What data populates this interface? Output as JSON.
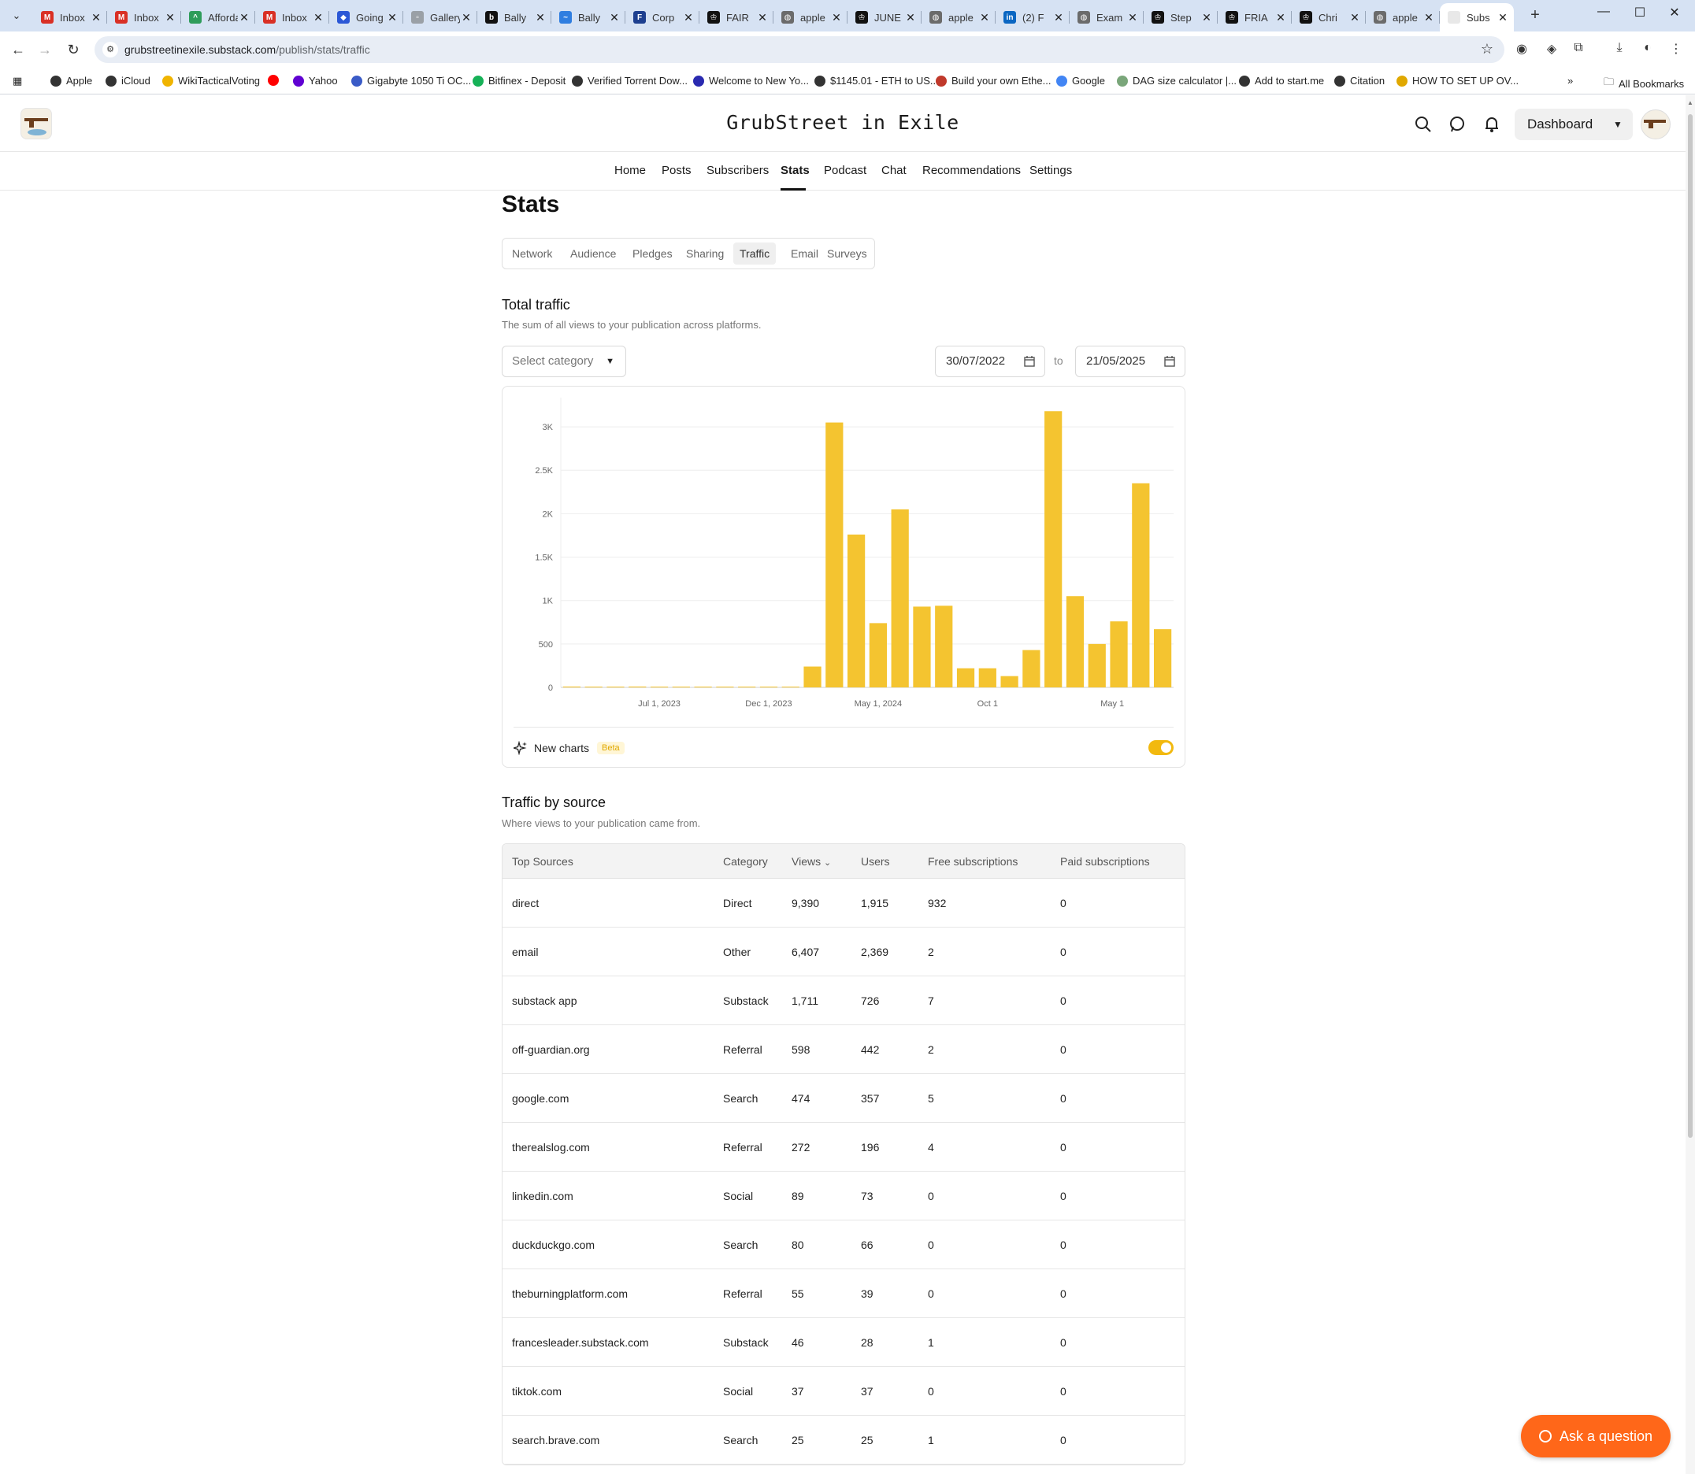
{
  "browser": {
    "tabs": [
      {
        "title": "Inbox",
        "favicon": "gmail-icon",
        "color": "#d93025",
        "glyph": "M"
      },
      {
        "title": "Inbox",
        "favicon": "gmail-icon",
        "color": "#d93025",
        "glyph": "M"
      },
      {
        "title": "Affordable",
        "favicon": "site-icon",
        "color": "#2e9c5a",
        "glyph": "^"
      },
      {
        "title": "Inbox",
        "favicon": "gmail-icon",
        "color": "#d93025",
        "glyph": "M"
      },
      {
        "title": "Going",
        "favicon": "site-icon",
        "color": "#2b57d6",
        "glyph": "◆"
      },
      {
        "title": "Gallery",
        "favicon": "site-icon",
        "color": "#9aa0a6",
        "glyph": "▫"
      },
      {
        "title": "Bally",
        "favicon": "site-icon",
        "color": "#111111",
        "glyph": "b"
      },
      {
        "title": "Bally",
        "favicon": "site-icon",
        "color": "#2f7ee0",
        "glyph": "~"
      },
      {
        "title": "Corp",
        "favicon": "site-icon",
        "color": "#1d3f8f",
        "glyph": "F"
      },
      {
        "title": "FAIR",
        "favicon": "site-icon",
        "color": "#111111",
        "glyph": "♔"
      },
      {
        "title": "apple",
        "favicon": "globe-icon",
        "color": "#6b6b6b",
        "glyph": "◍"
      },
      {
        "title": "JUNE",
        "favicon": "site-icon",
        "color": "#111111",
        "glyph": "♔"
      },
      {
        "title": "apple",
        "favicon": "globe-icon",
        "color": "#6b6b6b",
        "glyph": "◍"
      },
      {
        "title": "(2) F",
        "favicon": "linkedin-icon",
        "color": "#0a66c2",
        "glyph": "in"
      },
      {
        "title": "Exam",
        "favicon": "globe-icon",
        "color": "#6b6b6b",
        "glyph": "◍"
      },
      {
        "title": "Step",
        "favicon": "site-icon",
        "color": "#111111",
        "glyph": "♔"
      },
      {
        "title": "FRIA",
        "favicon": "site-icon",
        "color": "#111111",
        "glyph": "♔"
      },
      {
        "title": "Chri",
        "favicon": "site-icon",
        "color": "#111111",
        "glyph": "♔"
      },
      {
        "title": "apple",
        "favicon": "globe-icon",
        "color": "#6b6b6b",
        "glyph": "◍"
      },
      {
        "title": "Subs",
        "favicon": "substack-icon",
        "color": "#e8e8e8",
        "glyph": "",
        "active": true
      }
    ],
    "url_domain": "grubstreetinexile.substack.com",
    "url_path": "/publish/stats/traffic",
    "bookmarks": [
      {
        "label": "Apple",
        "color": "#333333"
      },
      {
        "label": "iCloud",
        "color": "#333333"
      },
      {
        "label": "WikiTacticalVoting",
        "color": "#f0b400"
      },
      {
        "label": "",
        "color": "#ff0000"
      },
      {
        "label": "Yahoo",
        "color": "#6001d2"
      },
      {
        "label": "Gigabyte 1050 Ti OC...",
        "color": "#3a5bc7"
      },
      {
        "label": "Bitfinex - Deposit",
        "color": "#16b157"
      },
      {
        "label": "Verified Torrent Dow...",
        "color": "#333333"
      },
      {
        "label": "Welcome to New Yo...",
        "color": "#2a2ab0"
      },
      {
        "label": "$1145.01 - ETH to US...",
        "color": "#333333"
      },
      {
        "label": "Build your own Ethe...",
        "color": "#c0392b"
      },
      {
        "label": "Google",
        "color": "#4285f4"
      },
      {
        "label": "DAG size calculator |...",
        "color": "#7aa67a"
      },
      {
        "label": "Add to start.me",
        "color": "#333333"
      },
      {
        "label": "Citation",
        "color": "#333333"
      },
      {
        "label": "HOW TO SET UP OV...",
        "color": "#e0a800"
      }
    ],
    "all_bookmarks": "All Bookmarks"
  },
  "header": {
    "pub_title": "GrubStreet in Exile",
    "dashboard_label": "Dashboard"
  },
  "nav": {
    "items": [
      "Home",
      "Posts",
      "Subscribers",
      "Stats",
      "Podcast",
      "Chat",
      "Recommendations",
      "Settings"
    ],
    "active": "Stats"
  },
  "page": {
    "title": "Stats",
    "subtabs": [
      "Network",
      "Audience",
      "Pledges",
      "Sharing",
      "Traffic",
      "Email",
      "Surveys"
    ],
    "active_subtab": "Traffic"
  },
  "total_traffic": {
    "title": "Total traffic",
    "subtitle": "The sum of all views to your publication across platforms.",
    "category_placeholder": "Select category",
    "date_from": "30/07/2022",
    "date_to": "21/05/2025",
    "to_label": "to",
    "new_charts_label": "New charts",
    "beta_label": "Beta",
    "toggle_on": true
  },
  "chart_data": {
    "type": "bar",
    "color": "#f4c430",
    "y_ticks": [
      "0",
      "500",
      "1K",
      "1.5K",
      "2K",
      "2.5K",
      "3K"
    ],
    "ylim": [
      0,
      3300
    ],
    "x_tick_labels": [
      "Jul 1, 2023",
      "Dec 1, 2023",
      "May 1, 2024",
      "Oct 1",
      "May 1"
    ],
    "x_tick_positions": [
      4.5,
      9.5,
      14.5,
      19.5,
      25.2
    ],
    "values": [
      10,
      5,
      3,
      10,
      8,
      6,
      5,
      3,
      3,
      2,
      2,
      240,
      3050,
      1760,
      740,
      2050,
      930,
      940,
      220,
      220,
      130,
      430,
      3180,
      1050,
      500,
      760,
      2350,
      670
    ],
    "grid": true
  },
  "traffic_by_source": {
    "title": "Traffic by source",
    "subtitle": "Where views to your publication came from.",
    "columns": [
      "Top Sources",
      "Category",
      "Views",
      "Users",
      "Free subscriptions",
      "Paid subscriptions"
    ],
    "rows": [
      [
        "direct",
        "Direct",
        "9,390",
        "1,915",
        "932",
        "0"
      ],
      [
        "email",
        "Other",
        "6,407",
        "2,369",
        "2",
        "0"
      ],
      [
        "substack app",
        "Substack",
        "1,711",
        "726",
        "7",
        "0"
      ],
      [
        "off-guardian.org",
        "Referral",
        "598",
        "442",
        "2",
        "0"
      ],
      [
        "google.com",
        "Search",
        "474",
        "357",
        "5",
        "0"
      ],
      [
        "therealslog.com",
        "Referral",
        "272",
        "196",
        "4",
        "0"
      ],
      [
        "linkedin.com",
        "Social",
        "89",
        "73",
        "0",
        "0"
      ],
      [
        "duckduckgo.com",
        "Search",
        "80",
        "66",
        "0",
        "0"
      ],
      [
        "theburningplatform.com",
        "Referral",
        "55",
        "39",
        "0",
        "0"
      ],
      [
        "francesleader.substack.com",
        "Substack",
        "46",
        "28",
        "1",
        "0"
      ],
      [
        "tiktok.com",
        "Social",
        "37",
        "37",
        "0",
        "0"
      ],
      [
        "search.brave.com",
        "Search",
        "25",
        "25",
        "1",
        "0"
      ]
    ]
  },
  "ask_button": "Ask a question",
  "colors": {
    "accent": "#ff6719",
    "chart_bar": "#f4c430",
    "toggle": "#f2b90f"
  }
}
